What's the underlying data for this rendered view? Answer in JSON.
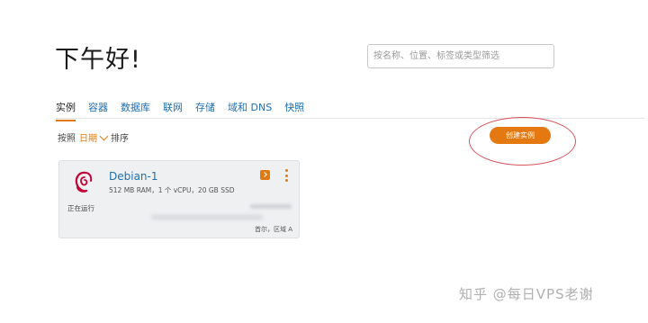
{
  "header": {
    "greeting": "下午好!",
    "search_placeholder": "按名称、位置、标签或类型筛选"
  },
  "tabs": [
    {
      "label": "实例",
      "active": true
    },
    {
      "label": "容器",
      "active": false
    },
    {
      "label": "数据库",
      "active": false
    },
    {
      "label": "联网",
      "active": false
    },
    {
      "label": "存储",
      "active": false
    },
    {
      "label": "域和 DNS",
      "active": false
    },
    {
      "label": "快照",
      "active": false
    }
  ],
  "sort": {
    "prefix": "按照",
    "selected": "日期",
    "suffix": "排序"
  },
  "create_button": {
    "label": "创建实例"
  },
  "instance": {
    "name": "Debian-1",
    "specs": "512 MB RAM，1 个 vCPU，20 GB SSD",
    "status": "正在运行",
    "region": "首尔，区域 A",
    "logo_icon": "debian-logo-icon"
  },
  "watermark": "知乎 @每日VPS老谢",
  "colors": {
    "accent": "#e47911",
    "link": "#1f6fb2",
    "card_bg": "#eef0f1",
    "annotation_ring": "#d9535b"
  }
}
